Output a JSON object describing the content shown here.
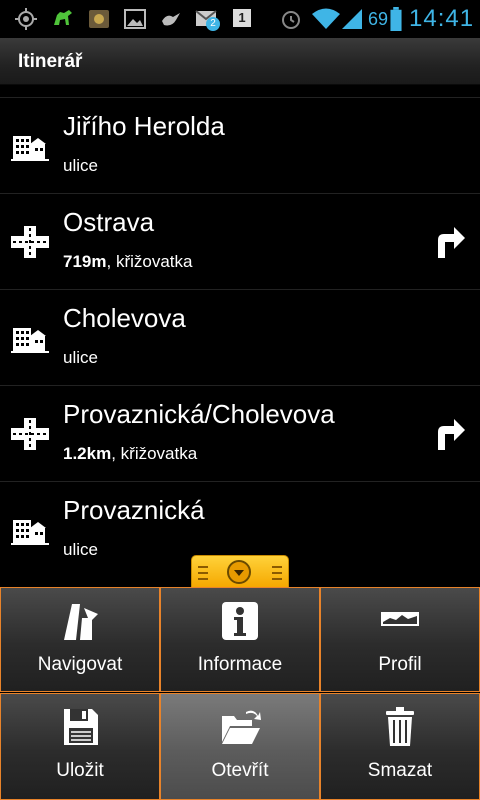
{
  "status_bar": {
    "battery_percent": "69",
    "clock": "14:41",
    "icons": [
      "gps-icon",
      "android-icon",
      "app-icon",
      "image-icon",
      "bird-icon",
      "gmail-icon",
      "calendar-icon",
      "alarm-icon",
      "wifi-icon",
      "signal-icon",
      "battery-icon"
    ],
    "gmail_badge": "2",
    "calendar_day": "1",
    "accent_color": "#3fb5e6"
  },
  "header": {
    "title": "Itinerář"
  },
  "itinerary": [
    {
      "name": "Jiřího Herolda",
      "distance": "",
      "type": "ulice",
      "icon": "street-building-icon",
      "turn": false
    },
    {
      "name": "Ostrava",
      "distance": "719m",
      "type": "křižovatka",
      "icon": "junction-icon",
      "turn": true
    },
    {
      "name": "Cholevova",
      "distance": "",
      "type": "ulice",
      "icon": "street-building-icon",
      "turn": false
    },
    {
      "name": "Provaznická/Cholevova",
      "distance": "1.2km",
      "type": "křižovatka",
      "icon": "junction-icon",
      "turn": true
    },
    {
      "name": "Provaznická",
      "distance": "",
      "type": "ulice",
      "icon": "street-building-icon",
      "turn": false
    }
  ],
  "separator": ", ",
  "menu": {
    "border_color": "#e8832a",
    "navigate": "Navigovat",
    "info": "Informace",
    "profile": "Profil",
    "save": "Uložit",
    "open": "Otevřít",
    "delete": "Smazat"
  }
}
